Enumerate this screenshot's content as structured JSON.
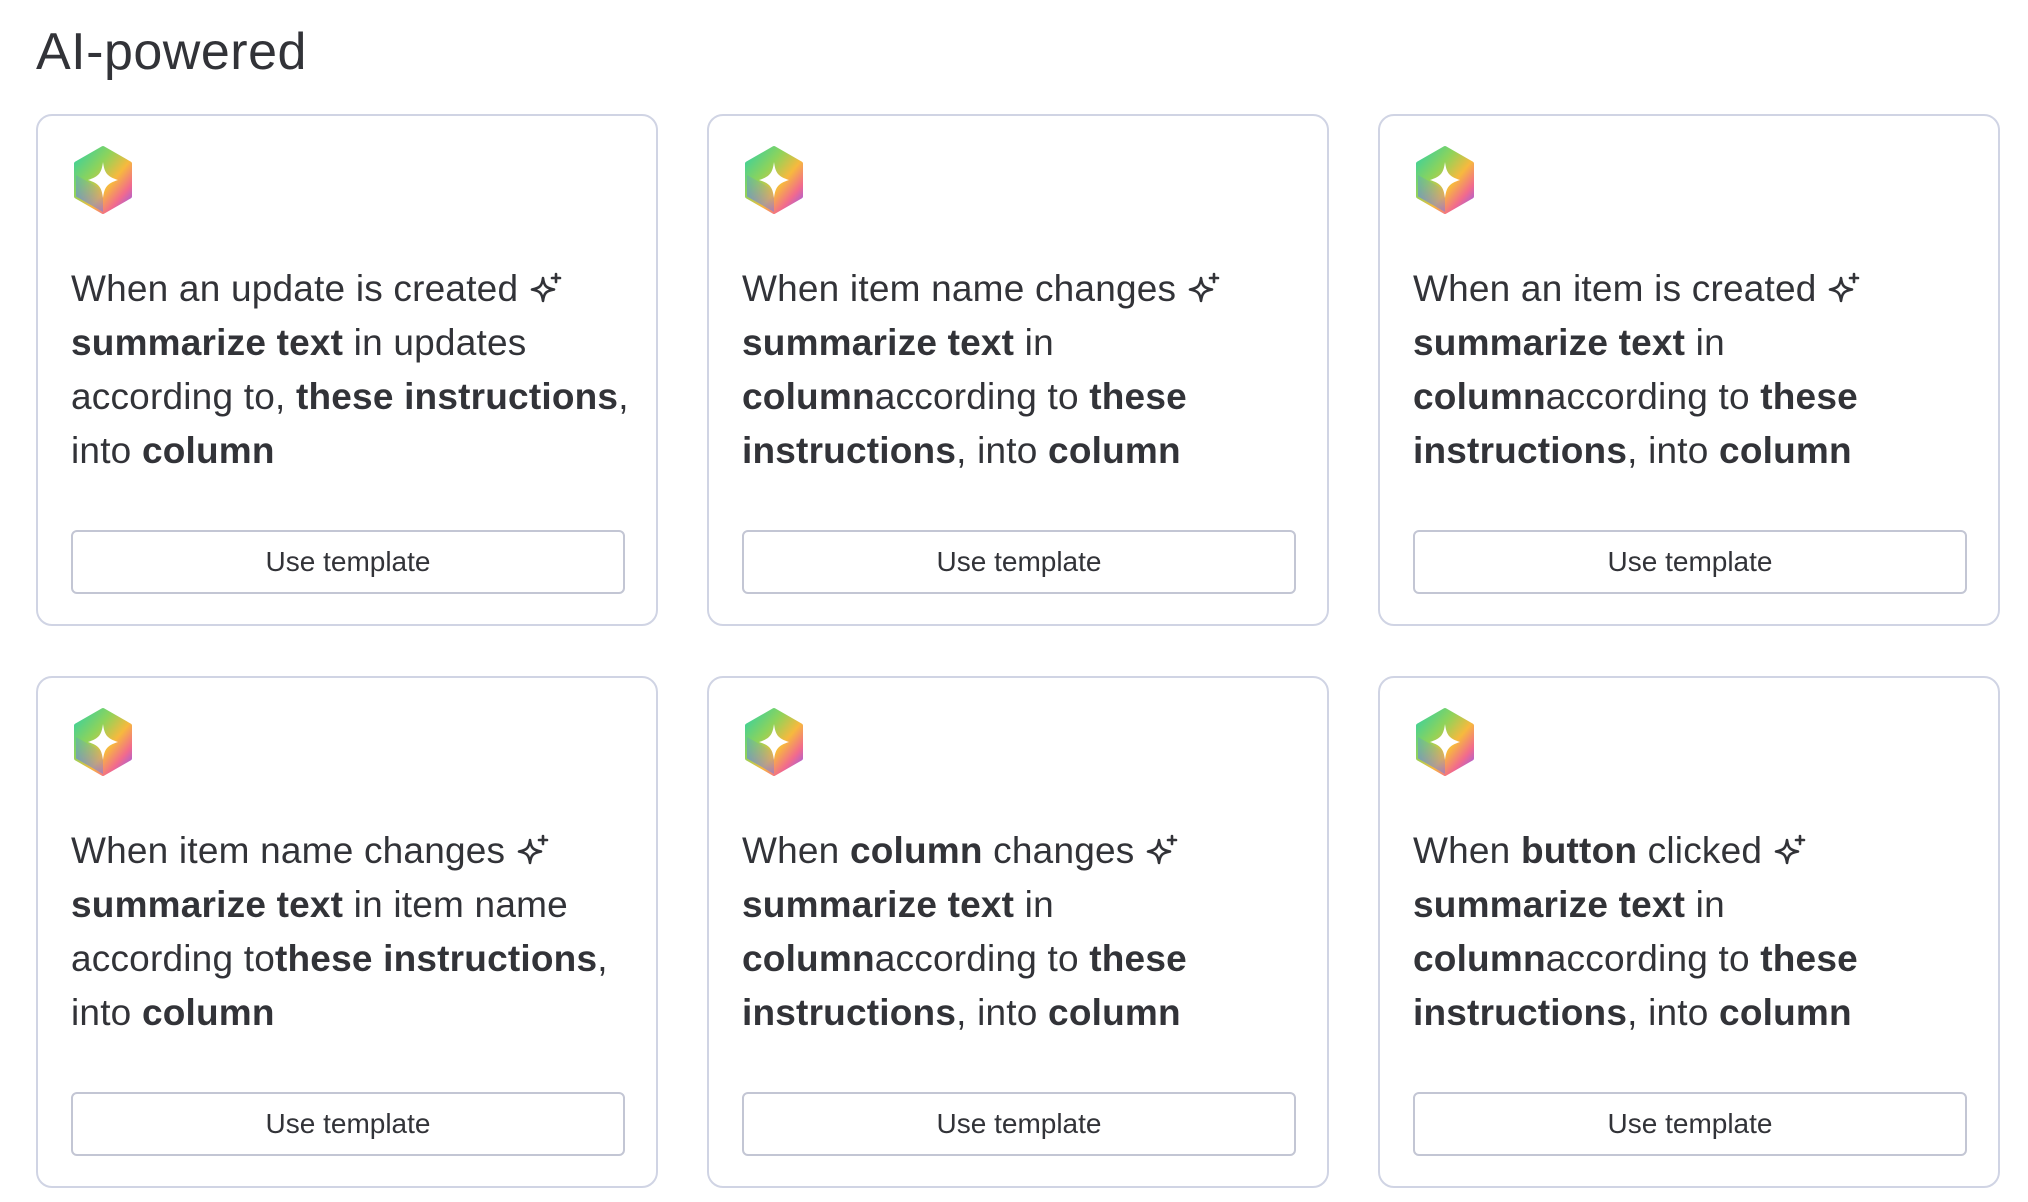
{
  "section": {
    "title": "AI-powered"
  },
  "icons": {
    "card_icon": "ai-hexagon-icon",
    "inline_icon": "sparkle-icon"
  },
  "colors": {
    "text": "#323338",
    "card_border": "#d0d4e4",
    "button_border": "#c3c6d4"
  },
  "cards": [
    {
      "segments": [
        {
          "text": "When an update is created",
          "bold": false
        },
        {
          "text": " ",
          "bold": false,
          "sparkle": true
        },
        {
          "text": "summarize text",
          "bold": true
        },
        {
          "text": " in updates according to, ",
          "bold": false
        },
        {
          "text": "these instructions",
          "bold": true
        },
        {
          "text": ", into ",
          "bold": false
        },
        {
          "text": "column",
          "bold": true
        }
      ],
      "button_label": "Use template"
    },
    {
      "segments": [
        {
          "text": "When item name changes",
          "bold": false
        },
        {
          "text": " ",
          "bold": false,
          "sparkle": true
        },
        {
          "text": "summarize text",
          "bold": true
        },
        {
          "text": " in ",
          "bold": false
        },
        {
          "text": "column",
          "bold": true
        },
        {
          "text": "according to ",
          "bold": false
        },
        {
          "text": "these instructions",
          "bold": true
        },
        {
          "text": ", into ",
          "bold": false
        },
        {
          "text": "column",
          "bold": true
        }
      ],
      "button_label": "Use template"
    },
    {
      "segments": [
        {
          "text": "When an item is created",
          "bold": false
        },
        {
          "text": " ",
          "bold": false,
          "sparkle": true
        },
        {
          "text": "summarize text",
          "bold": true
        },
        {
          "text": " in ",
          "bold": false
        },
        {
          "text": "column",
          "bold": true
        },
        {
          "text": "according to ",
          "bold": false
        },
        {
          "text": "these instructions",
          "bold": true
        },
        {
          "text": ", into ",
          "bold": false
        },
        {
          "text": "column",
          "bold": true
        }
      ],
      "button_label": "Use template"
    },
    {
      "segments": [
        {
          "text": "When item name changes",
          "bold": false
        },
        {
          "text": " ",
          "bold": false,
          "sparkle": true
        },
        {
          "text": "summarize text",
          "bold": true
        },
        {
          "text": " in item name according to",
          "bold": false
        },
        {
          "text": "these instructions",
          "bold": true
        },
        {
          "text": ", into ",
          "bold": false
        },
        {
          "text": "column",
          "bold": true
        }
      ],
      "button_label": "Use template"
    },
    {
      "segments": [
        {
          "text": "When ",
          "bold": false
        },
        {
          "text": "column",
          "bold": true
        },
        {
          "text": " changes",
          "bold": false
        },
        {
          "text": " ",
          "bold": false,
          "sparkle": true
        },
        {
          "text": "summarize text",
          "bold": true
        },
        {
          "text": " in ",
          "bold": false
        },
        {
          "text": "column",
          "bold": true
        },
        {
          "text": "according to ",
          "bold": false
        },
        {
          "text": "these instructions",
          "bold": true
        },
        {
          "text": ", into ",
          "bold": false
        },
        {
          "text": "column",
          "bold": true
        }
      ],
      "button_label": "Use template"
    },
    {
      "segments": [
        {
          "text": "When ",
          "bold": false
        },
        {
          "text": "button",
          "bold": true
        },
        {
          "text": " clicked",
          "bold": false
        },
        {
          "text": " ",
          "bold": false,
          "sparkle": true
        },
        {
          "text": "summarize text",
          "bold": true
        },
        {
          "text": " in ",
          "bold": false
        },
        {
          "text": "column",
          "bold": true
        },
        {
          "text": "according to ",
          "bold": false
        },
        {
          "text": "these instructions",
          "bold": true
        },
        {
          "text": ", into ",
          "bold": false
        },
        {
          "text": "column",
          "bold": true
        }
      ],
      "button_label": "Use template"
    }
  ]
}
